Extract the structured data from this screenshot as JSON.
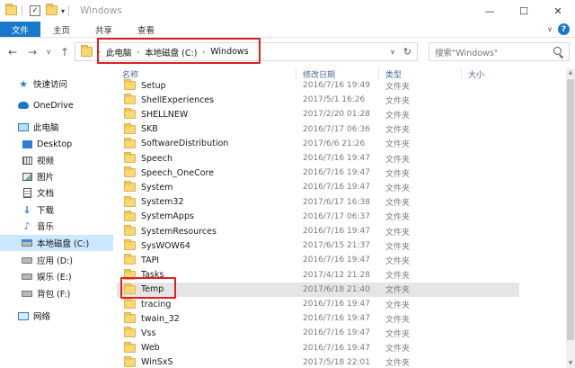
{
  "window": {
    "title": "Windows",
    "minimize": "—",
    "maximize": "☐",
    "close": "✕"
  },
  "ribbon": {
    "tabs": [
      "文件",
      "主页",
      "共享",
      "查看"
    ],
    "collapse": "∨",
    "help": "?"
  },
  "address": {
    "parts": [
      "此电脑",
      "本地磁盘 (C:)",
      "Windows"
    ],
    "separator": "›",
    "dropdown": "∨",
    "refresh": "↻"
  },
  "nav_buttons": {
    "back": "←",
    "forward": "→",
    "recent": "∨",
    "up": "↑"
  },
  "search": {
    "placeholder": "搜索\"Windows\""
  },
  "navpane": {
    "items": [
      {
        "label": "快速访问",
        "icon": "star-icon"
      },
      {
        "label": "OneDrive",
        "icon": "cloud-icon"
      },
      {
        "label": "此电脑",
        "icon": "computer-icon"
      },
      {
        "label": "Desktop",
        "icon": "desktop-icon"
      },
      {
        "label": "视频",
        "icon": "video-icon"
      },
      {
        "label": "图片",
        "icon": "picture-icon"
      },
      {
        "label": "文档",
        "icon": "document-icon"
      },
      {
        "label": "下载",
        "icon": "download-icon"
      },
      {
        "label": "音乐",
        "icon": "music-icon"
      },
      {
        "label": "本地磁盘 (C:)",
        "icon": "drive-c-icon"
      },
      {
        "label": "应用 (D:)",
        "icon": "drive-icon"
      },
      {
        "label": "娱乐 (E:)",
        "icon": "drive-icon"
      },
      {
        "label": "背包 (F:)",
        "icon": "drive-icon"
      },
      {
        "label": "网络",
        "icon": "network-icon"
      }
    ],
    "selected": "本地磁盘 (C:)"
  },
  "columns": {
    "name": "名称",
    "date": "修改日期",
    "type": "类型",
    "size": "大小"
  },
  "files": [
    {
      "name": "Setup",
      "date": "2016/7/16 19:49",
      "type": "文件夹"
    },
    {
      "name": "ShellExperiences",
      "date": "2017/5/1 16:26",
      "type": "文件夹"
    },
    {
      "name": "SHELLNEW",
      "date": "2017/2/20 01:28",
      "type": "文件夹"
    },
    {
      "name": "SKB",
      "date": "2016/7/17 06:36",
      "type": "文件夹"
    },
    {
      "name": "SoftwareDistribution",
      "date": "2017/6/6 21:26",
      "type": "文件夹"
    },
    {
      "name": "Speech",
      "date": "2016/7/16 19:47",
      "type": "文件夹"
    },
    {
      "name": "Speech_OneCore",
      "date": "2016/7/16 19:47",
      "type": "文件夹"
    },
    {
      "name": "System",
      "date": "2016/7/16 19:47",
      "type": "文件夹"
    },
    {
      "name": "System32",
      "date": "2017/6/17 16:38",
      "type": "文件夹"
    },
    {
      "name": "SystemApps",
      "date": "2016/7/17 06:37",
      "type": "文件夹"
    },
    {
      "name": "SystemResources",
      "date": "2016/7/16 19:47",
      "type": "文件夹"
    },
    {
      "name": "SysWOW64",
      "date": "2017/6/15 21:37",
      "type": "文件夹"
    },
    {
      "name": "TAPI",
      "date": "2016/7/16 19:47",
      "type": "文件夹"
    },
    {
      "name": "Tasks",
      "date": "2017/4/12 21:28",
      "type": "文件夹"
    },
    {
      "name": "Temp",
      "date": "2017/6/18 21:40",
      "type": "文件夹"
    },
    {
      "name": "tracing",
      "date": "2016/7/16 19:47",
      "type": "文件夹"
    },
    {
      "name": "twain_32",
      "date": "2016/7/16 19:47",
      "type": "文件夹"
    },
    {
      "name": "Vss",
      "date": "2016/7/16 19:47",
      "type": "文件夹"
    },
    {
      "name": "Web",
      "date": "2016/7/16 19:47",
      "type": "文件夹"
    },
    {
      "name": "WinSxS",
      "date": "2017/5/18 22:01",
      "type": "文件夹"
    }
  ],
  "selected_file": "Temp",
  "highlight_color": "#e02020",
  "accent_color": "#1979ca"
}
